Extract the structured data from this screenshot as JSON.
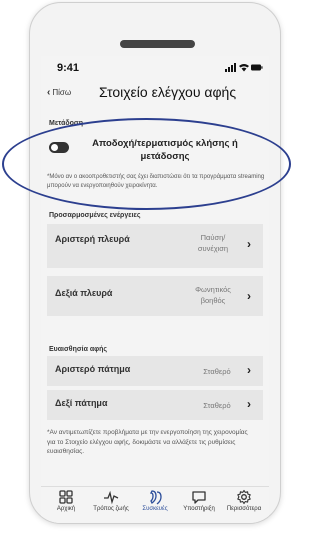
{
  "status": {
    "time": "9:41"
  },
  "header": {
    "back_label": "Πίσω",
    "title": "Στοιχείο ελέγχου αφής"
  },
  "transfer": {
    "section_label": "Μετάδοση",
    "toggle_label": "Αποδοχή/τερματισμός κλήσης ή μετάδοσης",
    "toggle_state": "off",
    "note": "*Μόνο αν ο ακοοπροθετιστής σας έχει διαπιστώσει ότι τα προγράμματα streaming μπορούν να ενεργοποιηθούν χειροκίνητα."
  },
  "custom_actions": {
    "section_label": "Προσαρμοσμένες ενέργειες",
    "rows": [
      {
        "label": "Αριστερή πλευρά",
        "value": "Παύση/ συνέχιση"
      },
      {
        "label": "Δεξιά πλευρά",
        "value": "Φωνητικός βοηθός"
      }
    ]
  },
  "touch_sensitivity": {
    "section_label": "Ευαισθησία αφής",
    "rows": [
      {
        "label": "Αριστερό πάτημα",
        "value": "Σταθερό"
      },
      {
        "label": "Δεξί πάτημα",
        "value": "Σταθερό"
      }
    ],
    "note": "*Αν αντιμετωπίζετε προβλήματα με την ενεργοποίηση της χειρονομίας για το Στοιχείο ελέγχου αφής, δοκιμάστε να αλλάξετε τις ρυθμίσεις ευαισθησίας."
  },
  "tabbar": {
    "tabs": [
      {
        "label": "Αρχική",
        "icon": "home-grid-icon"
      },
      {
        "label": "Τρόπος ζωής",
        "icon": "pulse-icon"
      },
      {
        "label": "Συσκευές",
        "icon": "hearing-aids-icon",
        "active": true
      },
      {
        "label": "Υποστήριξη",
        "icon": "chat-bubble-icon"
      },
      {
        "label": "Περισσότερα",
        "icon": "gear-icon"
      }
    ]
  },
  "colors": {
    "accent": "#2b4d9a",
    "highlight_ellipse": "#2c3f8f",
    "toggle_off": "#333333"
  }
}
